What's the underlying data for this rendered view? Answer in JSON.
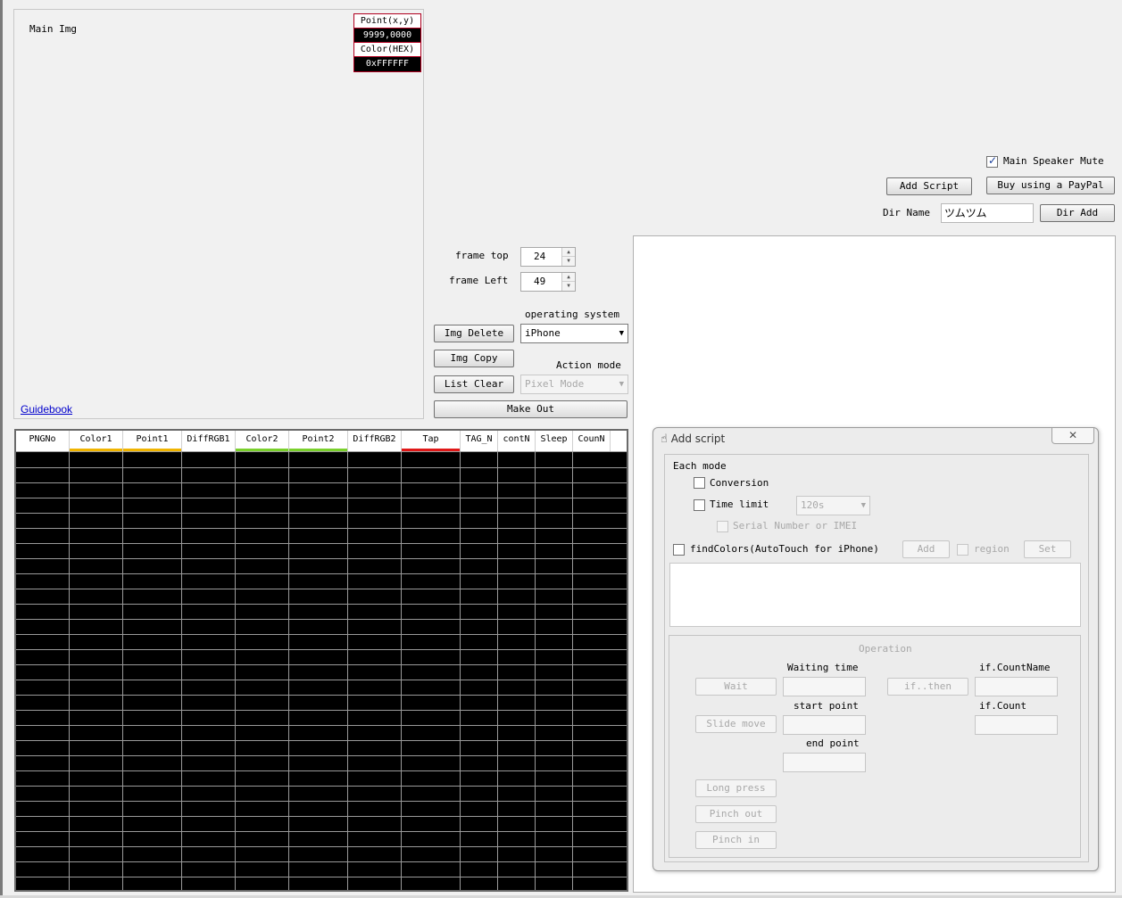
{
  "main_img": {
    "label": "Main Img",
    "point_label": "Point(x,y)",
    "point_value": "9999,0000",
    "color_label": "Color(HEX)",
    "color_value": "0xFFFFFF",
    "guidebook": "Guidebook"
  },
  "top_right": {
    "mute_label": "Main Speaker Mute",
    "mute_checked": true,
    "add_script": "Add Script",
    "paypal": "Buy using a PayPal",
    "dir_name_label": "Dir Name",
    "dir_name_value": "ツムツム",
    "dir_add": "Dir Add"
  },
  "controls": {
    "frame_top_label": "frame top",
    "frame_top_value": "24",
    "frame_left_label": "frame Left",
    "frame_left_value": "49",
    "os_label": "operating system",
    "os_value": "iPhone",
    "action_mode_label": "Action mode",
    "action_mode_value": "Pixel Mode",
    "img_delete": "Img Delete",
    "img_copy": "Img Copy",
    "list_clear": "List Clear",
    "make_out": "Make Out"
  },
  "grid": {
    "columns": [
      {
        "label": "PNGNo",
        "accent": ""
      },
      {
        "label": "Color1",
        "accent": "#f0b400"
      },
      {
        "label": "Point1",
        "accent": "#f0b400"
      },
      {
        "label": "DiffRGB1",
        "accent": ""
      },
      {
        "label": "Color2",
        "accent": "#7ad02c"
      },
      {
        "label": "Point2",
        "accent": "#7ad02c"
      },
      {
        "label": "DiffRGB2",
        "accent": ""
      },
      {
        "label": "Tap",
        "accent": "#e01818"
      },
      {
        "label": "TAG_N",
        "accent": ""
      },
      {
        "label": "contN",
        "accent": ""
      },
      {
        "label": "Sleep",
        "accent": ""
      },
      {
        "label": "CounN",
        "accent": ""
      }
    ]
  },
  "dialog": {
    "title": "Add script",
    "close": "✕",
    "each_mode": "Each mode",
    "conversion": "Conversion",
    "time_limit": "Time limit",
    "time_limit_value": "120s",
    "serial": "Serial Number or IMEI",
    "find_colors": "findColors(AutoTouch for iPhone)",
    "add": "Add",
    "region": "region",
    "set": "Set",
    "operation": "Operation",
    "wait": "Wait",
    "waiting_time": "Waiting time",
    "if_then": "if..then",
    "if_count_name": "if.CountName",
    "slide_move": "Slide move",
    "start_point": "start point",
    "if_count": "if.Count",
    "end_point": "end point",
    "long_press": "Long press",
    "pinch_out": "Pinch out",
    "pinch_in": "Pinch in"
  },
  "colors": {
    "accent_red": "#b00020",
    "link": "#0000cc"
  }
}
